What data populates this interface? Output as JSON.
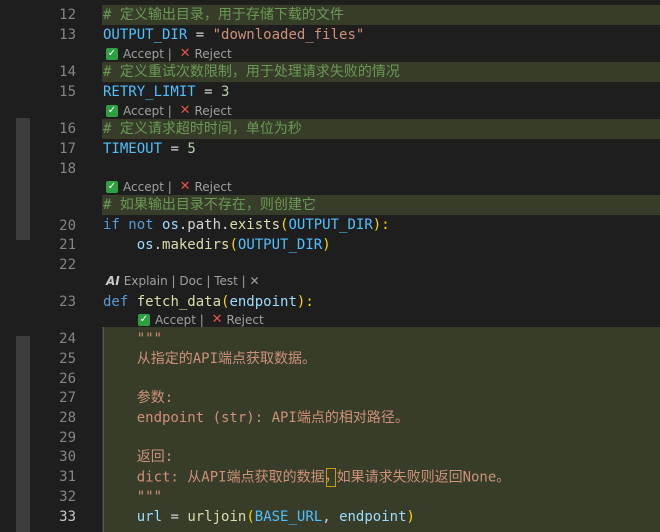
{
  "lines": {
    "n12": "12",
    "n13": "13",
    "n14": "14",
    "n15": "15",
    "n16": "16",
    "n17": "17",
    "n18": "18",
    "n20": "20",
    "n21": "21",
    "n22": "22",
    "n23": "23",
    "n24": "24",
    "n25": "25",
    "n26": "26",
    "n27": "27",
    "n28": "28",
    "n29": "29",
    "n30": "30",
    "n31": "31",
    "n32": "32",
    "n33": "33"
  },
  "code": {
    "l12_comment": "# 定义输出目录，用于存储下载的文件",
    "l13_var": "OUTPUT_DIR",
    "l13_eq": " = ",
    "l13_str": "\"downloaded_files\"",
    "l14_comment": "# 定义重试次数限制，用于处理请求失败的情况",
    "l15_var": "RETRY_LIMIT",
    "l15_eq": " = ",
    "l15_num": "3",
    "l16_comment": "# 定义请求超时时间，单位为秒",
    "l17_var": "TIMEOUT",
    "l17_eq": " = ",
    "l17_num": "5",
    "l19_comment": "# 如果输出目录不存在，则创建它",
    "l20_if": "if",
    "l20_not": " not ",
    "l20_os": "os",
    "l20_path": ".path.",
    "l20_exists": "exists",
    "l20_open": "(",
    "l20_arg": "OUTPUT_DIR",
    "l20_close": "):",
    "l21_indent": "    ",
    "l21_os": "os",
    "l21_dot": ".",
    "l21_fn": "makedirs",
    "l21_open": "(",
    "l21_arg": "OUTPUT_DIR",
    "l21_close": ")",
    "l23_def": "def",
    "l23_fn": " fetch_data",
    "l23_open": "(",
    "l23_param": "endpoint",
    "l23_close": "):",
    "l24": "    \"\"\"",
    "l25": "    从指定的API端点获取数据。",
    "l27": "    参数:",
    "l28": "    endpoint (str): API端点的相对路径。",
    "l30": "    返回:",
    "l31a": "    dict: 从API端点获取的数据",
    "l31b": "，",
    "l31c": "如果请求失败则返回None。",
    "l32": "    \"\"\"",
    "l33_indent": "    ",
    "l33_url": "url",
    "l33_eq": " = ",
    "l33_fn": "urljoin",
    "l33_open": "(",
    "l33_a1": "BASE_URL",
    "l33_comma": ", ",
    "l33_a2": "endpoint",
    "l33_close": ")"
  },
  "hints": {
    "accept": "Accept",
    "sep": " | ",
    "reject": "Reject",
    "check_icon": "✓",
    "x_icon": "✕",
    "codelens": "Explain | Doc | Test | ✕",
    "codelens_logo": "AI"
  },
  "colors": {
    "accept_green": "#2ea043",
    "reject_red": "#e5534b",
    "suggest_bg": "#373d29"
  }
}
